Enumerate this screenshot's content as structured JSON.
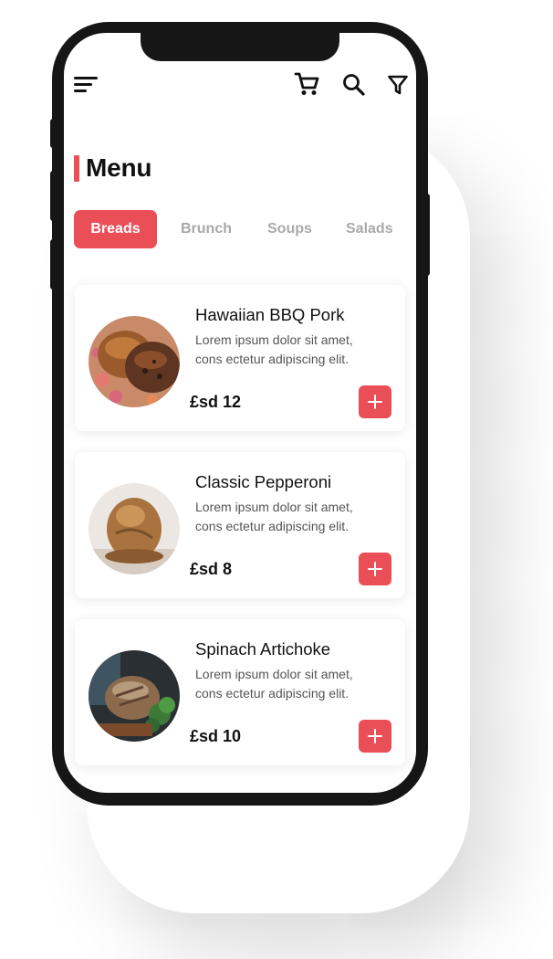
{
  "header": {
    "icons": [
      "menu-icon",
      "cart-icon",
      "search-icon",
      "filter-icon"
    ]
  },
  "page": {
    "title": "Menu"
  },
  "tabs": [
    {
      "label": "Breads",
      "active": true
    },
    {
      "label": "Brunch",
      "active": false
    },
    {
      "label": "Soups",
      "active": false
    },
    {
      "label": "Salads",
      "active": false
    }
  ],
  "items": [
    {
      "name": "Hawaiian BBQ Pork",
      "desc_line1": "Lorem ipsum dolor sit amet,",
      "desc_line2": "cons ectetur adipiscing elit.",
      "price": "£sd 12"
    },
    {
      "name": "Classic Pepperoni",
      "desc_line1": "Lorem ipsum dolor sit amet,",
      "desc_line2": "cons ectetur adipiscing elit.",
      "price": "£sd 8"
    },
    {
      "name": "Spinach Artichoke",
      "desc_line1": "Lorem ipsum dolor sit amet,",
      "desc_line2": "cons ectetur adipiscing elit.",
      "price": "£sd 10"
    }
  ],
  "colors": {
    "accent": "#ea4f58",
    "text": "#111111",
    "muted": "#a9a9a9"
  }
}
